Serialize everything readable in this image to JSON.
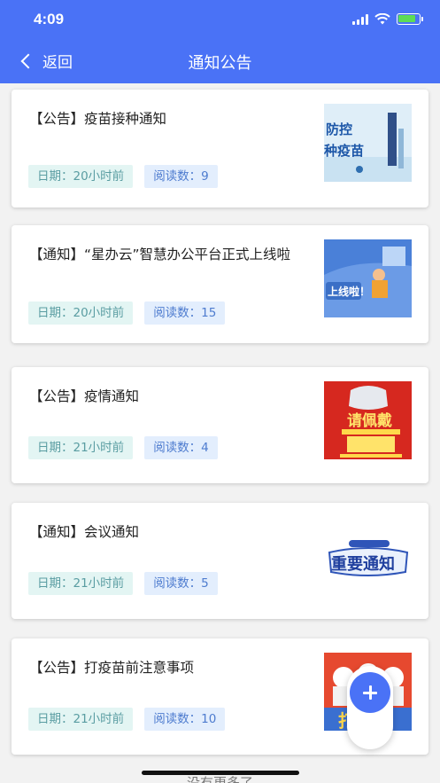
{
  "status_bar": {
    "time": "4:09"
  },
  "nav": {
    "back_label": "返回",
    "title": "通知公告"
  },
  "notices": [
    {
      "title": "【公告】疫苗接种通知",
      "date": "日期：20小时前",
      "reads": "阅读数：9",
      "thumb_text": "防控\n种疫苗"
    },
    {
      "title": "【通知】“星办云”智慧办公平台正式上线啦",
      "date": "日期：20小时前",
      "reads": "阅读数：15",
      "thumb_text": "上线啦！"
    },
    {
      "title": "【公告】疫情通知",
      "date": "日期：21小时前",
      "reads": "阅读数：4",
      "thumb_text": "请佩戴"
    },
    {
      "title": "【通知】会议通知",
      "date": "日期：21小时前",
      "reads": "阅读数：5",
      "thumb_text": "重要通知"
    },
    {
      "title": "【公告】打疫苗前注意事项",
      "date": "日期：21小时前",
      "reads": "阅读数：10",
      "thumb_text": "打疫苗"
    }
  ],
  "footer": {
    "text": "没有更多了"
  },
  "colors": {
    "primary": "#4a72f6",
    "tag_date_bg": "#e3f5f3",
    "tag_read_bg": "#e3eefd"
  }
}
